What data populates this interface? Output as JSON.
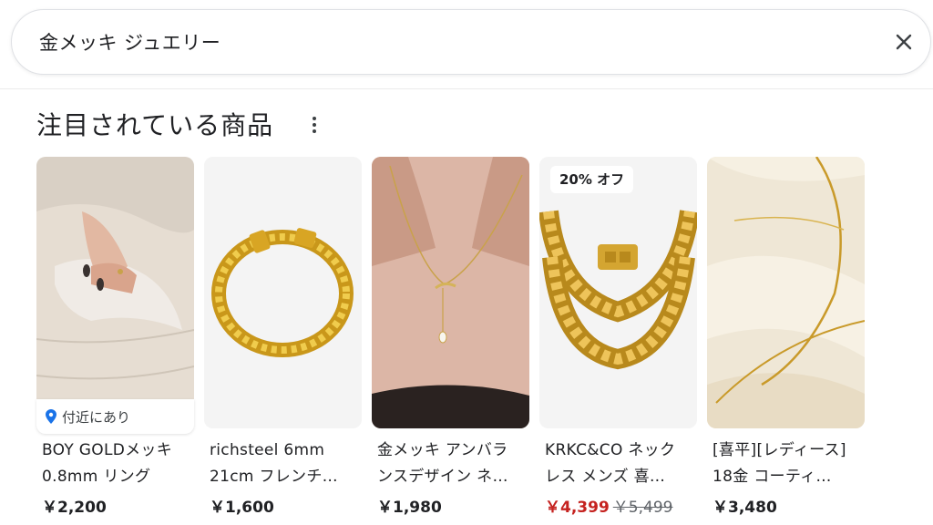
{
  "search": {
    "query": "金メッキ ジュエリー"
  },
  "section": {
    "title": "注目されている商品"
  },
  "products": [
    {
      "title_line1": "BOY GOLDメッキ",
      "title_line2": "0.8mm リング",
      "price": "￥2,200",
      "badge": "付近にあり"
    },
    {
      "title_line1": "richsteel 6mm",
      "title_line2": "21cm フレンチ…",
      "price": "￥1,600"
    },
    {
      "title_line1": "金メッキ アンバラ",
      "title_line2": "ンスデザイン ネ…",
      "price": "￥1,980"
    },
    {
      "title_line1": "KRKC&CO ネック",
      "title_line2": "レス メンズ 喜…",
      "price": "￥4,399",
      "old_price": "￥5,499",
      "badge": "20% オフ"
    },
    {
      "title_line1": "[喜平][レディース]",
      "title_line2": "18金 コーティ…",
      "price": "￥3,480"
    }
  ],
  "colors": {
    "sale_price": "#c5221f",
    "pin": "#1a73e8"
  }
}
